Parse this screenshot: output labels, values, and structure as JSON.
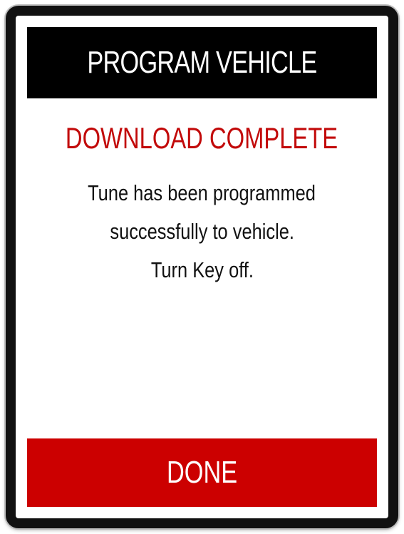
{
  "header": {
    "title": "PROGRAM VEHICLE"
  },
  "status": {
    "text": "DOWNLOAD COMPLETE",
    "color": "#cc0000"
  },
  "message": {
    "lines": [
      "Tune has been programmed",
      "successfully to vehicle.",
      "Turn Key off."
    ]
  },
  "actions": {
    "done_label": "DONE"
  },
  "colors": {
    "header_background": "#000000",
    "button_background": "#cc0000",
    "frame": "#111111"
  }
}
